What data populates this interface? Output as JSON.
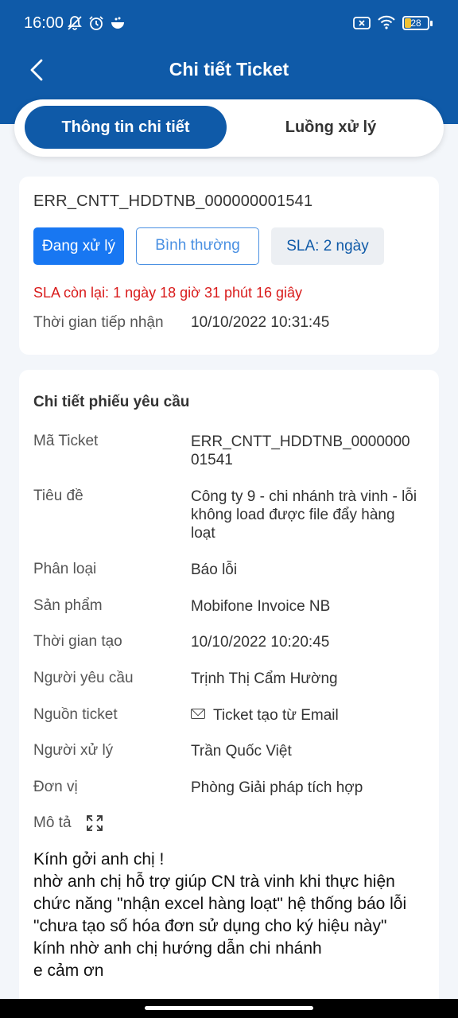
{
  "status_bar": {
    "time": "16:00",
    "battery": "28"
  },
  "header": {
    "title": "Chi tiết Ticket"
  },
  "tabs": [
    {
      "label": "Thông tin chi tiết"
    },
    {
      "label": "Luồng xử lý"
    }
  ],
  "summary": {
    "ticket_id": "ERR_CNTT_HDDTNB_000000001541",
    "status": "Đang xử lý",
    "priority": "Bình thường",
    "sla": "SLA: 2 ngày",
    "sla_remaining": "SLA còn lại: 1 ngày 18 giờ 31 phút 16 giây",
    "received_label": "Thời gian tiếp nhận",
    "received_value": "10/10/2022 10:31:45"
  },
  "details": {
    "title": "Chi tiết phiếu yêu cầu",
    "rows": [
      {
        "label": "Mã Ticket",
        "value": "ERR_CNTT_HDDTNB_0000000\n01541"
      },
      {
        "label": "Tiêu đề",
        "value": "Công ty 9 - chi nhánh trà vinh - lỗi không load được file đẩy hàng loạt"
      },
      {
        "label": "Phân loại",
        "value": "Báo lỗi"
      },
      {
        "label": "Sản phẩm",
        "value": "Mobifone Invoice NB"
      },
      {
        "label": "Thời gian tạo",
        "value": "10/10/2022 10:20:45"
      },
      {
        "label": "Người yêu cầu",
        "value": "Trịnh Thị Cẩm Hường"
      },
      {
        "label": "Nguồn ticket",
        "value": "Ticket tạo từ Email"
      },
      {
        "label": "Người xử lý",
        "value": "Trần Quốc Việt"
      },
      {
        "label": "Đơn vị",
        "value": "Phòng Giải pháp tích hợp"
      }
    ],
    "description_label": "Mô tả",
    "description": "Kính gởi anh chị !\nnhờ anh chị hỗ trợ giúp CN trà vinh khi thực hiện chức năng \"nhận excel hàng loạt\" hệ thống báo lỗi \"chưa tạo số hóa đơn sử dụng cho ký hiệu này\"\nkính nhờ anh chị hướng dẫn chi nhánh\ne cảm ơn"
  },
  "icons": {
    "back": "back-arrow-icon",
    "mute": "bell-off-icon",
    "alarm": "alarm-icon",
    "wifi": "wifi-icon",
    "mail": "mail-icon",
    "expand": "expand-icon"
  },
  "colors": {
    "primary": "#0f5aa8",
    "status_badge": "#1877f2",
    "sla_warning": "#d91c1c"
  }
}
